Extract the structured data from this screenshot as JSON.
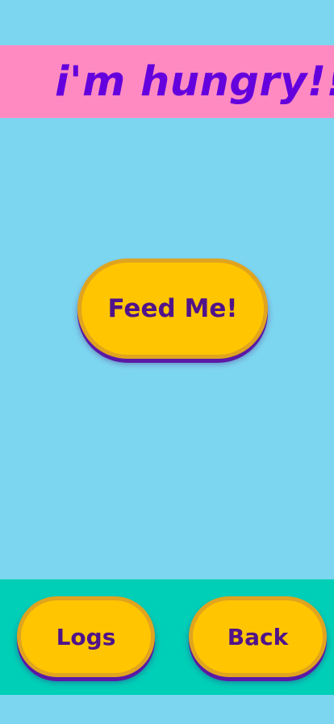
{
  "header": {
    "title": "i'm hungry!!"
  },
  "main": {
    "feed_label": "Feed Me!"
  },
  "footer": {
    "logs_label": "Logs",
    "back_label": "Back"
  },
  "colors": {
    "background": "#7dd6f0",
    "header_band": "#ff8ac2",
    "title_text": "#6400dd",
    "button_fill": "#ffc500",
    "button_border": "#e0a41f",
    "button_text": "#50138a",
    "footer_band": "#00cfb7"
  }
}
